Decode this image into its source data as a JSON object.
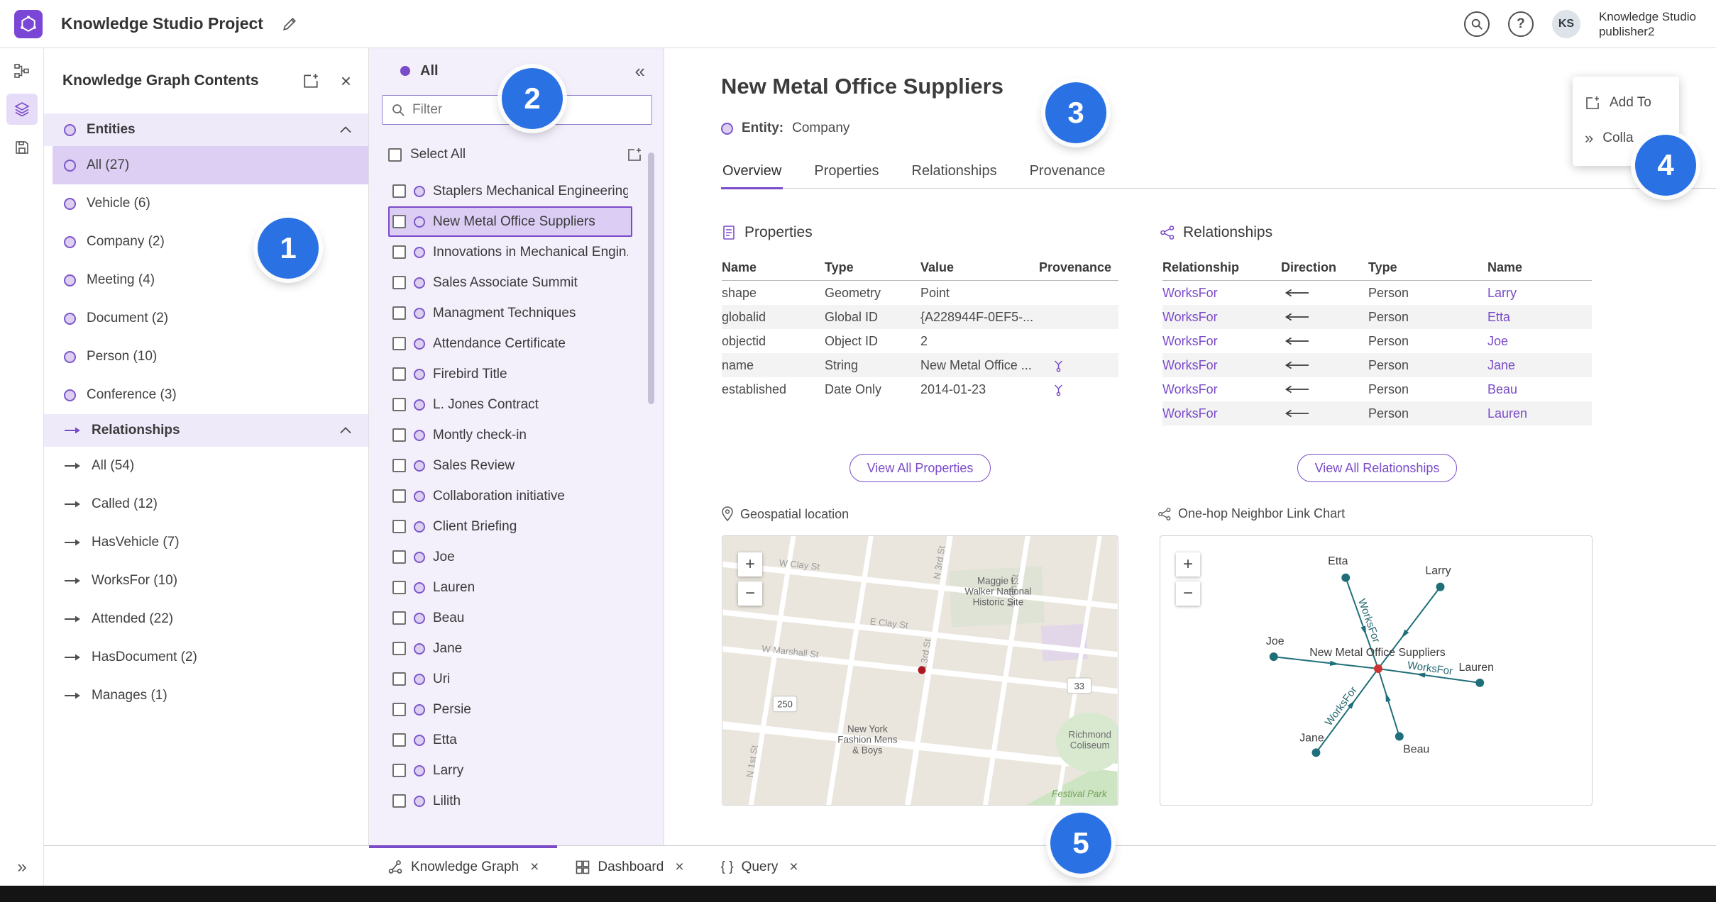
{
  "app": {
    "title": "Knowledge Studio Project",
    "user_initials": "KS",
    "user_line1": "Knowledge Studio",
    "user_line2": "publisher2"
  },
  "contents_panel": {
    "title": "Knowledge Graph Contents",
    "entities_header": "Entities",
    "entity_items": [
      "All (27)",
      "Vehicle (6)",
      "Company (2)",
      "Meeting (4)",
      "Document (2)",
      "Person (10)",
      "Conference (3)"
    ],
    "selected_entity": "All (27)",
    "relationships_header": "Relationships",
    "relationship_items": [
      "All (54)",
      "Called (12)",
      "HasVehicle (7)",
      "WorksFor (10)",
      "Attended (22)",
      "HasDocument (2)",
      "Manages (1)"
    ]
  },
  "list_panel": {
    "title": "All",
    "filter_placeholder": "Filter",
    "select_all": "Select All",
    "items": [
      "Staplers Mechanical Engineering",
      "New Metal Office Suppliers",
      "Innovations in Mechanical Engin...",
      "Sales Associate Summit",
      "Managment Techniques",
      "Attendance Certificate",
      "Firebird Title",
      "L. Jones Contract",
      "Montly check-in",
      "Sales Review",
      "Collaboration initiative",
      "Client Briefing",
      "Joe",
      "Lauren",
      "Beau",
      "Jane",
      "Uri",
      "Persie",
      "Etta",
      "Larry",
      "Lilith"
    ],
    "selected_item": "New Metal Office Suppliers"
  },
  "detail": {
    "title": "New Metal Office Suppliers",
    "entity_label": "Entity:",
    "entity_type": "Company",
    "tabs": [
      "Overview",
      "Properties",
      "Relationships",
      "Provenance"
    ],
    "active_tab": "Overview",
    "properties": {
      "heading": "Properties",
      "columns": [
        "Name",
        "Type",
        "Value",
        "Provenance"
      ],
      "rows": [
        {
          "name": "shape",
          "type": "Geometry",
          "value": "Point",
          "provenance": false
        },
        {
          "name": "globalid",
          "type": "Global ID",
          "value": "{A228944F-0EF5-...",
          "provenance": false
        },
        {
          "name": "objectid",
          "type": "Object ID",
          "value": "2",
          "provenance": false
        },
        {
          "name": "name",
          "type": "String",
          "value": "New Metal Office ...",
          "provenance": true
        },
        {
          "name": "established",
          "type": "Date Only",
          "value": "2014-01-23",
          "provenance": true
        }
      ],
      "view_all": "View All Properties"
    },
    "relationships": {
      "heading": "Relationships",
      "columns": [
        "Relationship",
        "Direction",
        "Type",
        "Name"
      ],
      "rows": [
        {
          "relationship": "WorksFor",
          "direction": "←",
          "type": "Person",
          "name": "Larry"
        },
        {
          "relationship": "WorksFor",
          "direction": "←",
          "type": "Person",
          "name": "Etta"
        },
        {
          "relationship": "WorksFor",
          "direction": "←",
          "type": "Person",
          "name": "Joe"
        },
        {
          "relationship": "WorksFor",
          "direction": "←",
          "type": "Person",
          "name": "Jane"
        },
        {
          "relationship": "WorksFor",
          "direction": "←",
          "type": "Person",
          "name": "Beau"
        },
        {
          "relationship": "WorksFor",
          "direction": "←",
          "type": "Person",
          "name": "Lauren"
        }
      ],
      "view_all": "View All Relationships"
    },
    "map": {
      "heading": "Geospatial location",
      "labels": {
        "site": "Maggie L.\nWalker National\nHistoric Site",
        "store": "New York\nFashion Mens\n& Boys",
        "coliseum": "Richmond\nColiseum",
        "park": "Festival Park"
      },
      "streets": [
        "W Clay St",
        "E Clay St",
        "W Marshall St",
        "N 1st St",
        "N 3rd St",
        "N 3rd St",
        "N 4th St"
      ],
      "route_shields": [
        "250",
        "33"
      ]
    },
    "link_chart": {
      "heading": "One-hop Neighbor Link Chart",
      "center_node": "New Metal Office Suppliers",
      "edge_label": "WorksFor",
      "nodes": [
        "Etta",
        "Larry",
        "Joe",
        "Lauren",
        "Jane",
        "Beau"
      ]
    }
  },
  "floating_actions": {
    "add_to": "Add To",
    "collapse": "Colla"
  },
  "bottom_tabs": [
    {
      "label": "Knowledge Graph",
      "active": true
    },
    {
      "label": "Dashboard",
      "active": false
    },
    {
      "label": "Query",
      "active": false
    }
  ],
  "annotations": [
    "1",
    "2",
    "3",
    "4",
    "5"
  ],
  "colors": {
    "accent_purple": "#7a4bc9",
    "teal": "#1f6f7a",
    "annotation_blue": "#2a72e3",
    "marker_red": "#ae1622"
  }
}
